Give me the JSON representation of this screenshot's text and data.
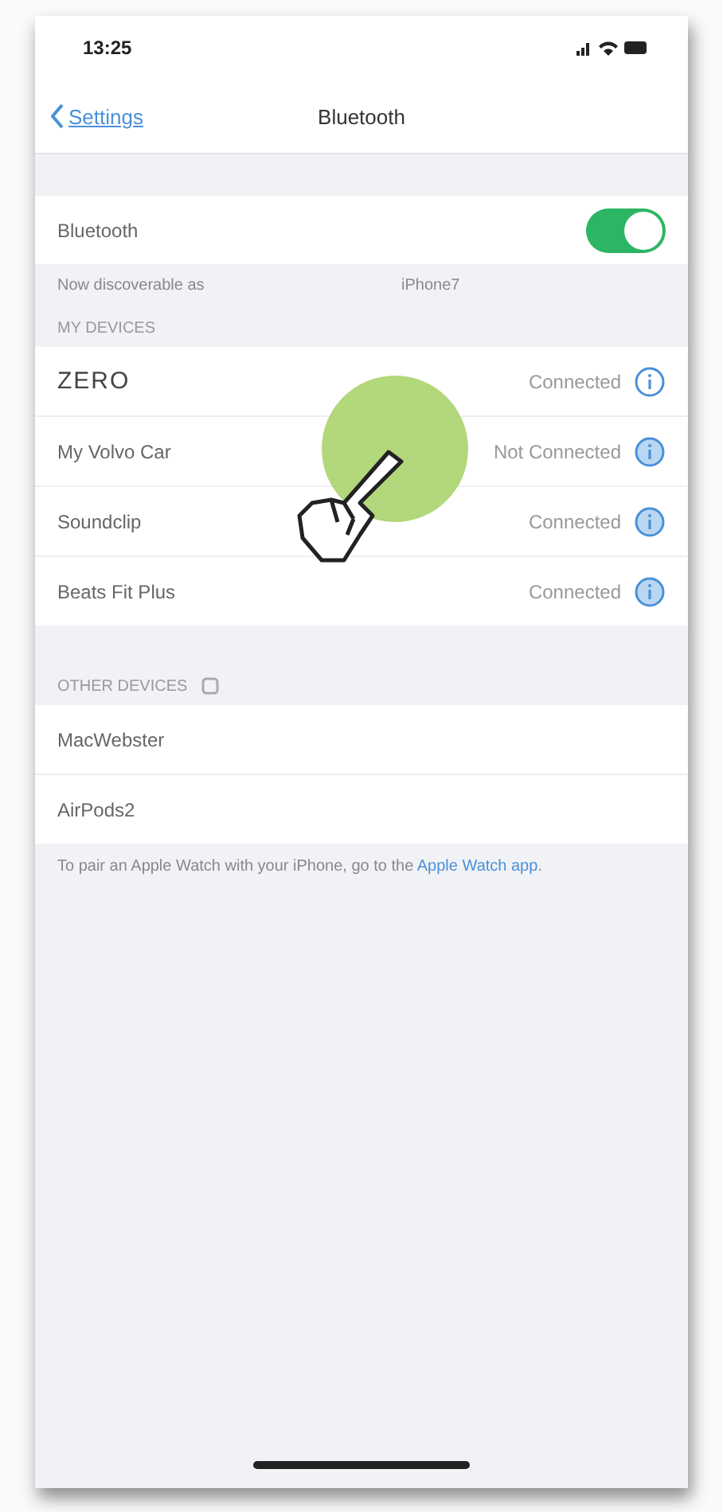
{
  "status_bar": {
    "time": "13:25"
  },
  "nav": {
    "back": "Settings",
    "title": "Bluetooth"
  },
  "bluetooth": {
    "label": "Bluetooth",
    "on": true
  },
  "discoverable": {
    "label": "Now discoverable as",
    "name": "iPhone7"
  },
  "my_devices": {
    "header": "MY DEVICES",
    "devices": [
      {
        "name": "ZERO",
        "status": "Connected"
      },
      {
        "name": "My Volvo Car",
        "status": "Not Connected"
      },
      {
        "name": "Soundclip",
        "status": "Connected"
      },
      {
        "name": "Beats Fit Plus",
        "status": "Connected"
      }
    ]
  },
  "other_devices": {
    "header": "OTHER DEVICES",
    "searching": true,
    "devices": [
      {
        "name": "MacWebster"
      },
      {
        "name": "AirPods2"
      }
    ]
  },
  "footer": {
    "text": "To pair an Apple Watch with your iPhone, go to the ",
    "link": "Apple Watch app",
    "end": "."
  },
  "tap_overlay": true
}
